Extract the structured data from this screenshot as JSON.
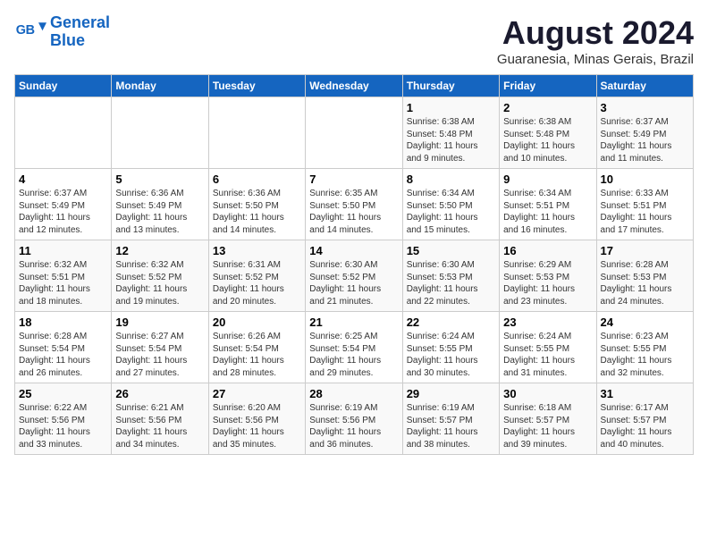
{
  "header": {
    "logo_line1": "General",
    "logo_line2": "Blue",
    "month_year": "August 2024",
    "location": "Guaranesia, Minas Gerais, Brazil"
  },
  "weekdays": [
    "Sunday",
    "Monday",
    "Tuesday",
    "Wednesday",
    "Thursday",
    "Friday",
    "Saturday"
  ],
  "weeks": [
    [
      {
        "day": "",
        "info": ""
      },
      {
        "day": "",
        "info": ""
      },
      {
        "day": "",
        "info": ""
      },
      {
        "day": "",
        "info": ""
      },
      {
        "day": "1",
        "info": "Sunrise: 6:38 AM\nSunset: 5:48 PM\nDaylight: 11 hours\nand 9 minutes."
      },
      {
        "day": "2",
        "info": "Sunrise: 6:38 AM\nSunset: 5:48 PM\nDaylight: 11 hours\nand 10 minutes."
      },
      {
        "day": "3",
        "info": "Sunrise: 6:37 AM\nSunset: 5:49 PM\nDaylight: 11 hours\nand 11 minutes."
      }
    ],
    [
      {
        "day": "4",
        "info": "Sunrise: 6:37 AM\nSunset: 5:49 PM\nDaylight: 11 hours\nand 12 minutes."
      },
      {
        "day": "5",
        "info": "Sunrise: 6:36 AM\nSunset: 5:49 PM\nDaylight: 11 hours\nand 13 minutes."
      },
      {
        "day": "6",
        "info": "Sunrise: 6:36 AM\nSunset: 5:50 PM\nDaylight: 11 hours\nand 14 minutes."
      },
      {
        "day": "7",
        "info": "Sunrise: 6:35 AM\nSunset: 5:50 PM\nDaylight: 11 hours\nand 14 minutes."
      },
      {
        "day": "8",
        "info": "Sunrise: 6:34 AM\nSunset: 5:50 PM\nDaylight: 11 hours\nand 15 minutes."
      },
      {
        "day": "9",
        "info": "Sunrise: 6:34 AM\nSunset: 5:51 PM\nDaylight: 11 hours\nand 16 minutes."
      },
      {
        "day": "10",
        "info": "Sunrise: 6:33 AM\nSunset: 5:51 PM\nDaylight: 11 hours\nand 17 minutes."
      }
    ],
    [
      {
        "day": "11",
        "info": "Sunrise: 6:32 AM\nSunset: 5:51 PM\nDaylight: 11 hours\nand 18 minutes."
      },
      {
        "day": "12",
        "info": "Sunrise: 6:32 AM\nSunset: 5:52 PM\nDaylight: 11 hours\nand 19 minutes."
      },
      {
        "day": "13",
        "info": "Sunrise: 6:31 AM\nSunset: 5:52 PM\nDaylight: 11 hours\nand 20 minutes."
      },
      {
        "day": "14",
        "info": "Sunrise: 6:30 AM\nSunset: 5:52 PM\nDaylight: 11 hours\nand 21 minutes."
      },
      {
        "day": "15",
        "info": "Sunrise: 6:30 AM\nSunset: 5:53 PM\nDaylight: 11 hours\nand 22 minutes."
      },
      {
        "day": "16",
        "info": "Sunrise: 6:29 AM\nSunset: 5:53 PM\nDaylight: 11 hours\nand 23 minutes."
      },
      {
        "day": "17",
        "info": "Sunrise: 6:28 AM\nSunset: 5:53 PM\nDaylight: 11 hours\nand 24 minutes."
      }
    ],
    [
      {
        "day": "18",
        "info": "Sunrise: 6:28 AM\nSunset: 5:54 PM\nDaylight: 11 hours\nand 26 minutes."
      },
      {
        "day": "19",
        "info": "Sunrise: 6:27 AM\nSunset: 5:54 PM\nDaylight: 11 hours\nand 27 minutes."
      },
      {
        "day": "20",
        "info": "Sunrise: 6:26 AM\nSunset: 5:54 PM\nDaylight: 11 hours\nand 28 minutes."
      },
      {
        "day": "21",
        "info": "Sunrise: 6:25 AM\nSunset: 5:54 PM\nDaylight: 11 hours\nand 29 minutes."
      },
      {
        "day": "22",
        "info": "Sunrise: 6:24 AM\nSunset: 5:55 PM\nDaylight: 11 hours\nand 30 minutes."
      },
      {
        "day": "23",
        "info": "Sunrise: 6:24 AM\nSunset: 5:55 PM\nDaylight: 11 hours\nand 31 minutes."
      },
      {
        "day": "24",
        "info": "Sunrise: 6:23 AM\nSunset: 5:55 PM\nDaylight: 11 hours\nand 32 minutes."
      }
    ],
    [
      {
        "day": "25",
        "info": "Sunrise: 6:22 AM\nSunset: 5:56 PM\nDaylight: 11 hours\nand 33 minutes."
      },
      {
        "day": "26",
        "info": "Sunrise: 6:21 AM\nSunset: 5:56 PM\nDaylight: 11 hours\nand 34 minutes."
      },
      {
        "day": "27",
        "info": "Sunrise: 6:20 AM\nSunset: 5:56 PM\nDaylight: 11 hours\nand 35 minutes."
      },
      {
        "day": "28",
        "info": "Sunrise: 6:19 AM\nSunset: 5:56 PM\nDaylight: 11 hours\nand 36 minutes."
      },
      {
        "day": "29",
        "info": "Sunrise: 6:19 AM\nSunset: 5:57 PM\nDaylight: 11 hours\nand 38 minutes."
      },
      {
        "day": "30",
        "info": "Sunrise: 6:18 AM\nSunset: 5:57 PM\nDaylight: 11 hours\nand 39 minutes."
      },
      {
        "day": "31",
        "info": "Sunrise: 6:17 AM\nSunset: 5:57 PM\nDaylight: 11 hours\nand 40 minutes."
      }
    ]
  ]
}
